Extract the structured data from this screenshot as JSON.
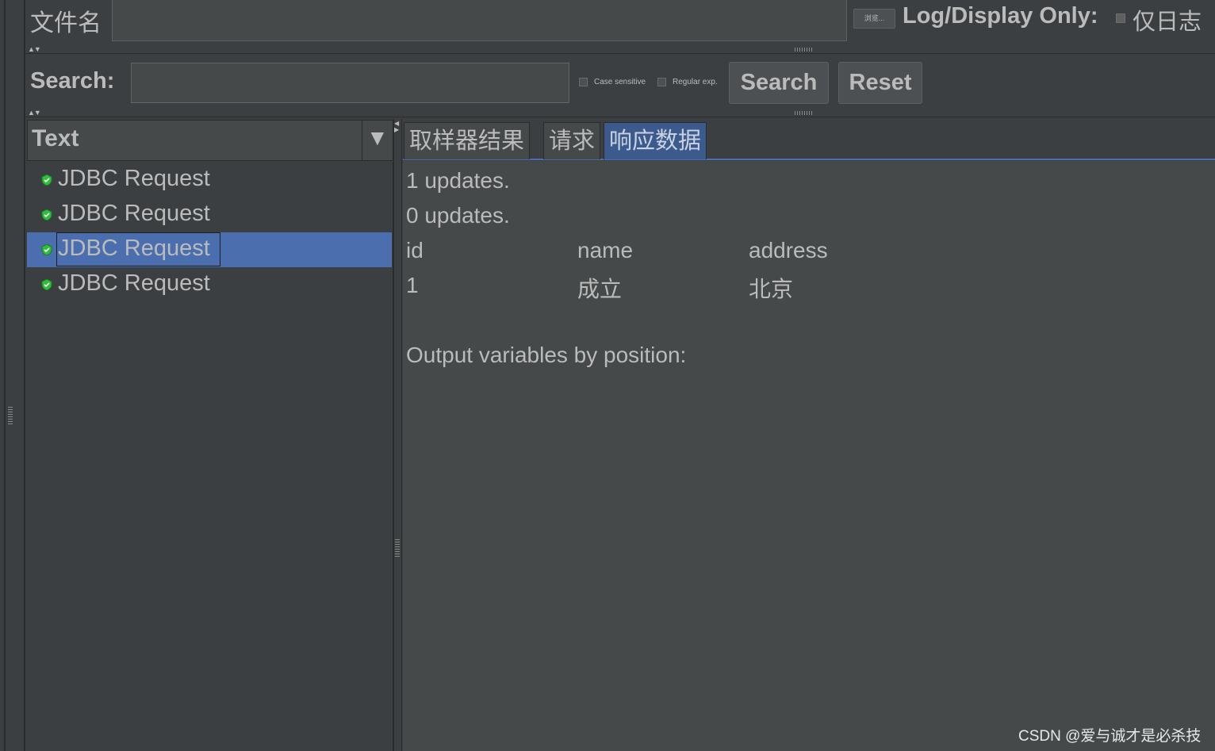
{
  "file_row": {
    "label": "文件名",
    "file_value": "",
    "browse_label": "浏览...",
    "log_display_label": "Log/Display Only:",
    "log_only_label": "仅日志"
  },
  "search_row": {
    "label": "Search:",
    "value": "",
    "case_sensitive_label": "Case sensitive",
    "regular_exp_label": "Regular exp.",
    "search_button": "Search",
    "reset_button": "Reset"
  },
  "tree": {
    "header_label": "Text",
    "dropdown_glyph": "▼",
    "items": [
      {
        "label": "JDBC Request",
        "status": "success",
        "selected": false
      },
      {
        "label": "JDBC Request",
        "status": "success",
        "selected": false
      },
      {
        "label": "JDBC Request",
        "status": "success",
        "selected": true
      },
      {
        "label": "JDBC Request",
        "status": "success",
        "selected": false
      }
    ]
  },
  "tabs": [
    {
      "label": "取样器结果",
      "active": false
    },
    {
      "label": "请求",
      "active": false
    },
    {
      "label": "响应数据",
      "active": true
    }
  ],
  "response": {
    "lines": [
      "1 updates.",
      "0 updates."
    ],
    "table": {
      "headers": [
        "id",
        "name",
        "address"
      ],
      "rows": [
        [
          "1",
          "成立",
          "北京"
        ]
      ]
    },
    "footer": "Output variables by position:"
  },
  "watermark": "CSDN @爱与诚才是必杀技",
  "colors": {
    "background": "#3c3f41",
    "selection": "#4b6eaf",
    "active_tab": "#3c5b8c",
    "success_icon": "#2fbf3a"
  }
}
